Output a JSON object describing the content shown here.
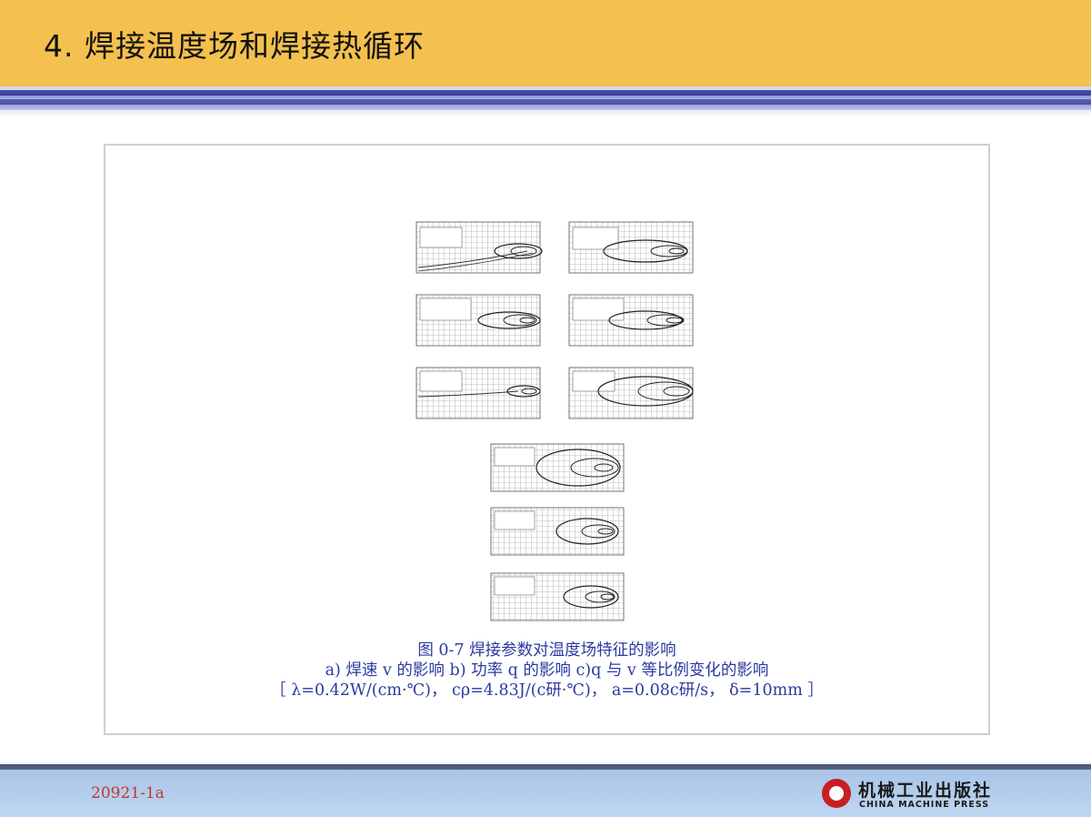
{
  "header": {
    "title": "4.  焊接温度场和焊接热循环"
  },
  "figure": {
    "caption_line1": "图 0-7    焊接参数对温度场特征的影响",
    "caption_line2": "a) 焊速 v 的影响    b) 功率 q 的影响    c)q 与 v 等比例变化的影响",
    "caption_line3": "［ λ=0.42W/(cm·℃)，   cρ=4.83J/(c研·℃)，   a=0.08c研/s，    δ=10mm ］"
  },
  "footer": {
    "code": "20921-1a",
    "publisher_cn": "机械工业出版社",
    "publisher_en": "CHINA MACHINE PRESS"
  },
  "colors": {
    "title_bar": "#f4c04e",
    "stripe_blue": "#3b3f98",
    "caption_text": "#2a3aa0",
    "footer_code": "#c0392b",
    "footer_bar": "#bdd7f2",
    "logo_red": "#c81e24"
  }
}
